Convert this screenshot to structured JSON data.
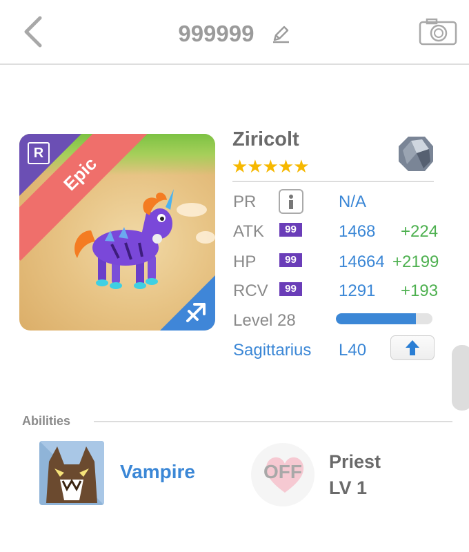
{
  "header": {
    "title": "999999"
  },
  "card": {
    "rarity": "Epic",
    "rarity_badge": "R",
    "rarity_color": "#6b4fb4",
    "ribbon_color": "#ef6f6b",
    "zodiac_icon": "sagittarius-arrow-icon"
  },
  "pet": {
    "name": "Ziricolt",
    "stars": "★★★★★",
    "star_count": 5,
    "element_icon": "stone-gem-icon"
  },
  "stats": {
    "pr": {
      "label": "PR",
      "value": "N/A"
    },
    "atk": {
      "label": "ATK",
      "level": "99",
      "value": "1468",
      "bonus": "+224"
    },
    "hp": {
      "label": "HP",
      "level": "99",
      "value": "14664",
      "bonus": "+2199"
    },
    "rcv": {
      "label": "RCV",
      "level": "99",
      "value": "1291",
      "bonus": "+193"
    },
    "level": {
      "label": "Level 28",
      "progress": 0.83
    },
    "sign": {
      "label": "Sagittarius",
      "level": "L40"
    }
  },
  "abilities": {
    "label": "Abilities",
    "ability1": {
      "name": "Vampire"
    },
    "ability2": {
      "status": "OFF",
      "name": "Priest",
      "level": "LV 1"
    }
  },
  "colors": {
    "accent": "#3b87d6",
    "bonus": "#4db04f",
    "star": "#f6b800"
  }
}
